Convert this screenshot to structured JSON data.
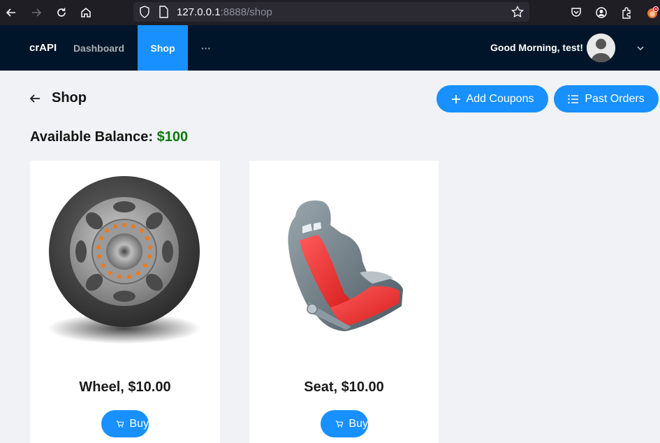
{
  "browser": {
    "url_host": "127.0.0.1",
    "url_path": ":8888/shop"
  },
  "header": {
    "brand": "crAPI",
    "nav": [
      {
        "label": "Dashboard"
      },
      {
        "label": "Shop"
      },
      {
        "label": "···"
      }
    ],
    "greeting": "Good Morning, test!"
  },
  "page": {
    "title": "Shop",
    "add_coupons_label": "Add Coupons",
    "past_orders_label": "Past Orders",
    "balance_label": "Available Balance:",
    "balance_value": "$100"
  },
  "products": [
    {
      "name": "Wheel, $10.00",
      "buy_label": "Buy",
      "image": "wheel-image"
    },
    {
      "name": "Seat, $10.00",
      "buy_label": "Buy",
      "image": "seat-image"
    }
  ],
  "colors": {
    "header_bg": "#001529",
    "accent": "#1890ff",
    "balance": "#0a7a0a",
    "page_bg": "#f0f2f5"
  }
}
